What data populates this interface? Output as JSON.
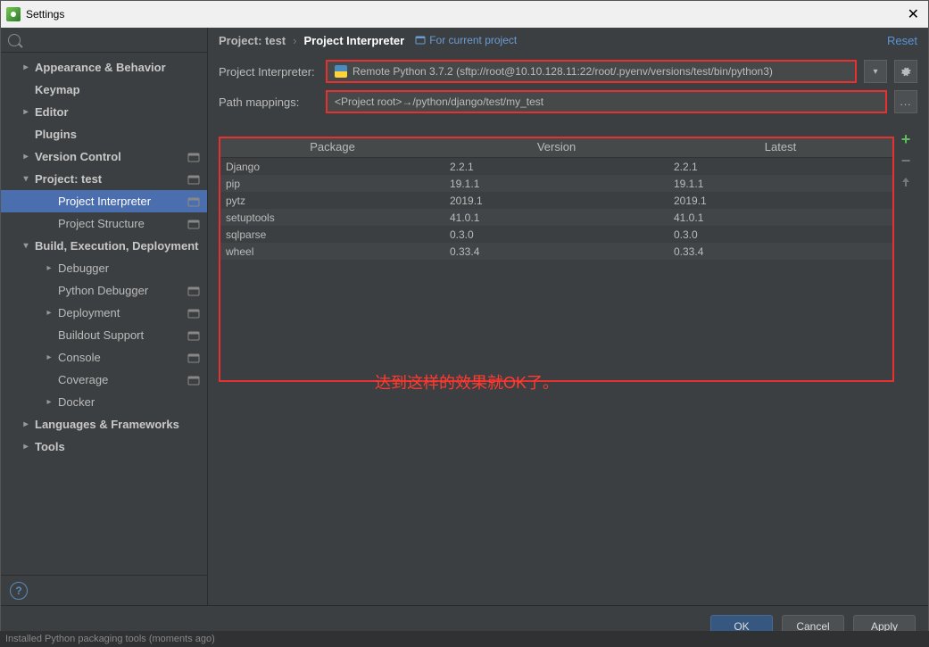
{
  "window": {
    "title": "Settings"
  },
  "sidebar": {
    "search_placeholder": "",
    "items": [
      {
        "label": "Appearance & Behavior",
        "bold": true,
        "exp": "collapsed",
        "level": 1
      },
      {
        "label": "Keymap",
        "bold": true,
        "level": 1
      },
      {
        "label": "Editor",
        "bold": true,
        "exp": "collapsed",
        "level": 1
      },
      {
        "label": "Plugins",
        "bold": true,
        "level": 1
      },
      {
        "label": "Version Control",
        "bold": true,
        "exp": "collapsed",
        "level": 1,
        "scope": true
      },
      {
        "label": "Project: test",
        "bold": true,
        "exp": "expanded",
        "level": 1,
        "scope": true
      },
      {
        "label": "Project Interpreter",
        "level": 2,
        "selected": true,
        "scope": true
      },
      {
        "label": "Project Structure",
        "level": 2,
        "scope": true
      },
      {
        "label": "Build, Execution, Deployment",
        "bold": true,
        "exp": "expanded",
        "level": 1
      },
      {
        "label": "Debugger",
        "exp": "collapsed",
        "level": 2
      },
      {
        "label": "Python Debugger",
        "level": 2,
        "scope": true
      },
      {
        "label": "Deployment",
        "exp": "collapsed",
        "level": 2,
        "scope": true
      },
      {
        "label": "Buildout Support",
        "level": 2,
        "scope": true
      },
      {
        "label": "Console",
        "exp": "collapsed",
        "level": 2,
        "scope": true
      },
      {
        "label": "Coverage",
        "level": 2,
        "scope": true
      },
      {
        "label": "Docker",
        "exp": "collapsed",
        "level": 2
      },
      {
        "label": "Languages & Frameworks",
        "bold": true,
        "exp": "collapsed",
        "level": 1
      },
      {
        "label": "Tools",
        "bold": true,
        "exp": "collapsed",
        "level": 1
      }
    ]
  },
  "breadcrumb": {
    "project": "Project: test",
    "current": "Project Interpreter",
    "badge": "For current project",
    "reset": "Reset"
  },
  "form": {
    "interpreter_label": "Project Interpreter:",
    "interpreter_value": "Remote Python 3.7.2 (sftp://root@10.10.128.11:22/root/.pyenv/versions/test/bin/python3)",
    "mappings_label": "Path mappings:",
    "mappings_value": "<Project root>→/python/django/test/my_test"
  },
  "table": {
    "headers": {
      "pkg": "Package",
      "ver": "Version",
      "latest": "Latest"
    },
    "rows": [
      {
        "pkg": "Django",
        "ver": "2.2.1",
        "latest": "2.2.1"
      },
      {
        "pkg": "pip",
        "ver": "19.1.1",
        "latest": "19.1.1"
      },
      {
        "pkg": "pytz",
        "ver": "2019.1",
        "latest": "2019.1"
      },
      {
        "pkg": "setuptools",
        "ver": "41.0.1",
        "latest": "41.0.1"
      },
      {
        "pkg": "sqlparse",
        "ver": "0.3.0",
        "latest": "0.3.0"
      },
      {
        "pkg": "wheel",
        "ver": "0.33.4",
        "latest": "0.33.4"
      }
    ]
  },
  "annotation": "达到这样的效果就OK了。",
  "footer": {
    "ok": "OK",
    "cancel": "Cancel",
    "apply": "Apply"
  },
  "status": "Installed Python packaging tools (moments ago)"
}
